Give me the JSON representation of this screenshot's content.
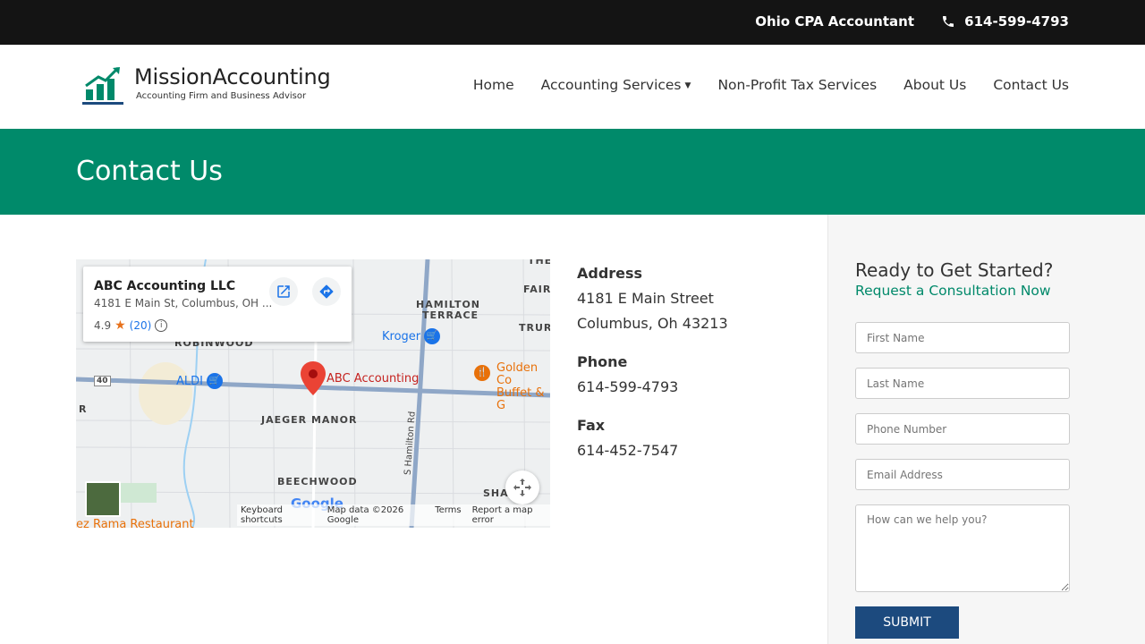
{
  "topbar": {
    "tagline": "Ohio CPA Accountant",
    "phone": "614-599-4793"
  },
  "logo": {
    "brand": "MissionAccounting",
    "tagline": "Accounting Firm and Business Advisor"
  },
  "nav": [
    {
      "label": "Home"
    },
    {
      "label": "Accounting Services"
    },
    {
      "label": "Non-Profit Tax Services"
    },
    {
      "label": "About Us"
    },
    {
      "label": "Contact Us"
    }
  ],
  "banner": {
    "title": "Contact Us"
  },
  "map": {
    "place_name": "ABC Accounting LLC",
    "place_address": "4181 E Main St, Columbus, OH ...",
    "rating": "4.9",
    "review_count": "(20)",
    "labels": {
      "hamilton_terrace_1": "HAMILTON",
      "hamilton_terrace_2": "TERRACE",
      "robinwood": "ROBINWOOD",
      "jaeger_manor": "JAEGER MANOR",
      "beechwood": "BEECHWOOD",
      "fair": "FAIR",
      "trur": "TRUR",
      "the": "THE",
      "sha": "SHA",
      "s_hamilton": "S Hamilton Rd",
      "route": "40",
      "r": "R"
    },
    "pois": {
      "kroger": "Kroger",
      "aldi": "ALDI",
      "abc": "ABC Accounting",
      "golden_1": "Golden Co",
      "golden_2": "Buffet & G",
      "rama": "ez Rama Restaurant"
    },
    "google_logo": "Google",
    "footer": [
      "Keyboard shortcuts",
      "Map data ©2026 Google",
      "Terms",
      "Report a map error"
    ]
  },
  "contact": {
    "address_label": "Address",
    "address_line1": "4181 E Main Street",
    "address_line2": "Columbus, Oh 43213",
    "phone_label": "Phone",
    "phone": "614-599-4793",
    "fax_label": "Fax",
    "fax": "614-452-7547"
  },
  "form": {
    "heading": "Ready to Get Started?",
    "subheading": "Request a Consultation Now",
    "first_name_placeholder": "First Name",
    "last_name_placeholder": "Last Name",
    "phone_placeholder": "Phone Number",
    "email_placeholder": "Email Address",
    "message_placeholder": "How can we help you?",
    "submit_label": "SUBMIT"
  },
  "colors": {
    "brand_green": "#008a6a",
    "topbar": "#141414",
    "submit_blue": "#1c4a7e"
  }
}
